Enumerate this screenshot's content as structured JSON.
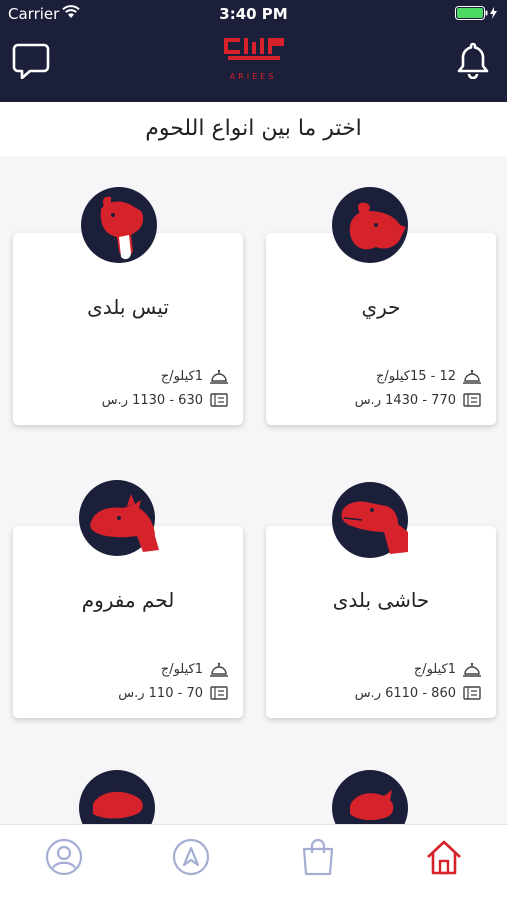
{
  "status_bar": {
    "carrier": "Carrier",
    "time": "3:40 PM"
  },
  "header": {
    "logo_text": "ARIEES",
    "left_icon": "chat-icon",
    "right_icon": "bell-icon"
  },
  "page": {
    "subtitle": "اختر ما بين انواع اللحوم"
  },
  "products": [
    {
      "name": "حري",
      "weight": "12 - 15كيلو/ج",
      "price": "770 - 1430 ر.س",
      "icon": "sheep-head-icon"
    },
    {
      "name": "تيس بلدى",
      "weight": "1كيلو/ج",
      "price": "630 - 1130 ر.س",
      "icon": "goat-head-icon"
    },
    {
      "name": "حاشى بلدى",
      "weight": "1كيلو/ج",
      "price": "860 - 6110 ر.س",
      "icon": "camel-head-icon"
    },
    {
      "name": "لحم مفروم",
      "weight": "1كيلو/ج",
      "price": "70 - 110 ر.س",
      "icon": "cow-head-icon"
    }
  ],
  "tabs": [
    {
      "name": "profile",
      "icon": "user-icon",
      "active": false
    },
    {
      "name": "navigate",
      "icon": "compass-icon",
      "active": false
    },
    {
      "name": "cart",
      "icon": "shopping-bag-icon",
      "active": false
    },
    {
      "name": "home",
      "icon": "home-icon",
      "active": true
    }
  ],
  "colors": {
    "header_bg": "#1c1f3a",
    "accent": "#d6222a",
    "tab_inactive": "#a4aed3"
  }
}
